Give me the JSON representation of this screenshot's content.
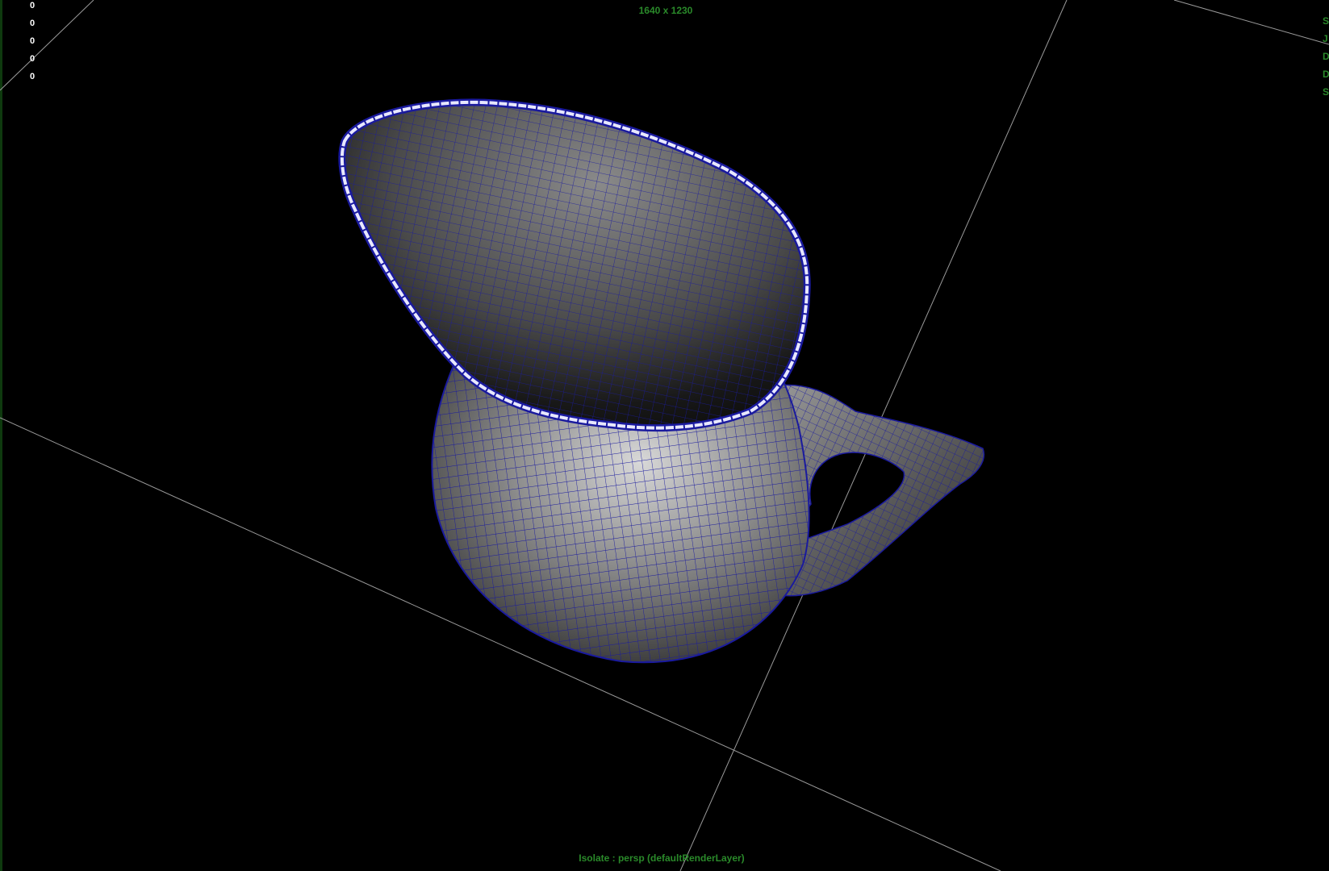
{
  "viewport": {
    "resolution_gate": "1640 x 1230",
    "isolate_label": "Isolate : persp (defaultRenderLayer)",
    "hud_counters": [
      "0",
      "0",
      "0",
      "0",
      "0"
    ],
    "hud_right_clipped": [
      "S",
      "J",
      "D",
      "D",
      "S"
    ],
    "background_color": "#000000",
    "hud_color": "#2a8a2a",
    "wireframe_color": "#1a1a9e"
  },
  "object": {
    "type": "pitcher",
    "display": "smooth shaded with wireframe on shaded"
  }
}
